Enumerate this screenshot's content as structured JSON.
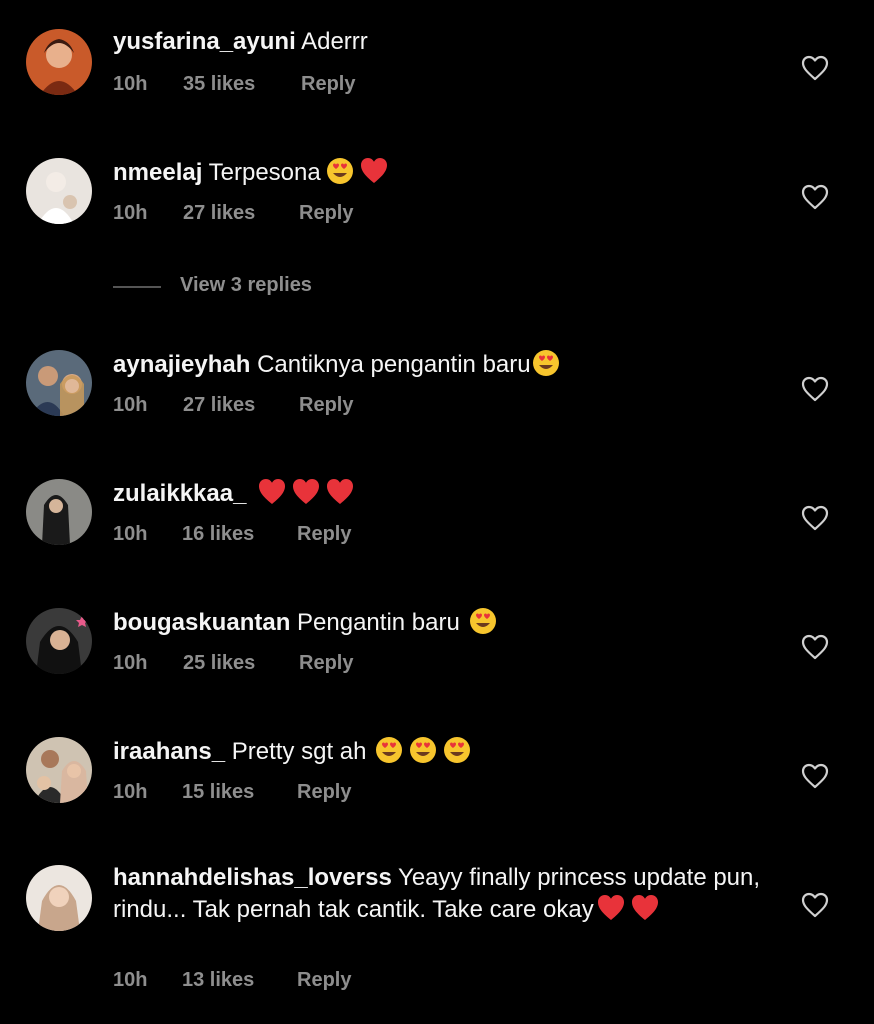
{
  "comments": [
    {
      "username": "yusfarina_ayuni",
      "text": "Aderrr",
      "emojis": [],
      "time": "10h",
      "likes": "35 likes",
      "reply": "Reply"
    },
    {
      "username": "nmeelaj",
      "text": "Terpesona",
      "emojis": [
        "heart-eyes",
        "red-heart"
      ],
      "time": "10h",
      "likes": "27 likes",
      "reply": "Reply"
    },
    {
      "username": "aynajieyhah",
      "text": "Cantiknya pengantin baru",
      "emojis": [
        "heart-eyes"
      ],
      "time": "10h",
      "likes": "27 likes",
      "reply": "Reply"
    },
    {
      "username": "zulaikkkaa_",
      "text": "",
      "emojis": [
        "red-heart",
        "red-heart",
        "red-heart"
      ],
      "time": "10h",
      "likes": "16 likes",
      "reply": "Reply"
    },
    {
      "username": "bougaskuantan",
      "text": "Pengantin baru",
      "emojis": [
        "heart-eyes"
      ],
      "time": "10h",
      "likes": "25 likes",
      "reply": "Reply"
    },
    {
      "username": "iraahans_",
      "text": "Pretty sgt ah",
      "emojis": [
        "heart-eyes",
        "heart-eyes",
        "heart-eyes"
      ],
      "time": "10h",
      "likes": "15 likes",
      "reply": "Reply"
    },
    {
      "username": "hannahdelishas_loverss",
      "text": "Yeayy finally princess update pun, rindu... Tak pernah tak cantik. Take care okay",
      "emojis": [
        "red-heart",
        "red-heart"
      ],
      "time": "10h",
      "likes": "13 likes",
      "reply": "Reply"
    }
  ],
  "view_replies": {
    "label": "View 3 replies"
  },
  "colors": {
    "background": "#000000",
    "text": "#f5f5f5",
    "muted": "#8e8e8e"
  },
  "icons": {
    "like": "heart-outline-icon"
  }
}
